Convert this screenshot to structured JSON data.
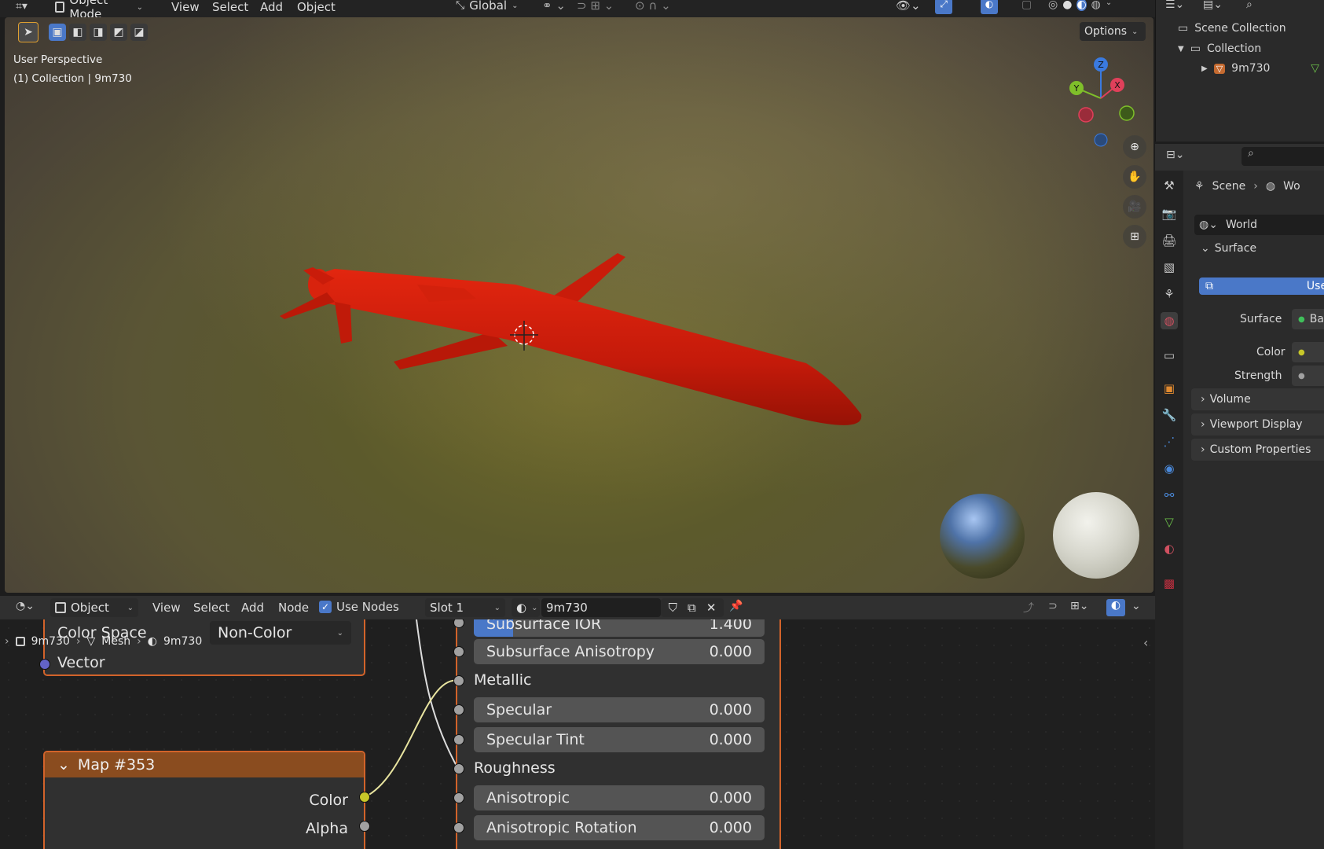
{
  "header": {
    "mode": "Object Mode",
    "menus": [
      "View",
      "Select",
      "Add",
      "Object"
    ],
    "transform_orientation": "Global"
  },
  "tool_header": {
    "options": "Options"
  },
  "viewport": {
    "perspective": "User Perspective",
    "collection_info": "(1) Collection | 9m730",
    "gizmo": {
      "z": "Z",
      "y": "Y",
      "x": "X"
    }
  },
  "node_header": {
    "object": "Object",
    "menus": [
      "View",
      "Select",
      "Add",
      "Node"
    ],
    "use_nodes": "Use Nodes",
    "slot": "Slot 1",
    "material": "9m730"
  },
  "breadcrumb": {
    "object": "9m730",
    "mesh": "Mesh",
    "material": "9m730"
  },
  "nodes": {
    "image_node": {
      "color_space_label": "Color Space",
      "color_space_value": "Non-Color",
      "vector": "Vector"
    },
    "map_node": {
      "title": "Map #353",
      "color": "Color",
      "alpha": "Alpha"
    },
    "bsdf": {
      "subsurface_ior": {
        "label": "Subsurface IOR",
        "value": "1.400"
      },
      "subsurface_anisotropy": {
        "label": "Subsurface Anisotropy",
        "value": "0.000"
      },
      "metallic": "Metallic",
      "specular": {
        "label": "Specular",
        "value": "0.000"
      },
      "specular_tint": {
        "label": "Specular Tint",
        "value": "0.000"
      },
      "roughness": "Roughness",
      "anisotropic": {
        "label": "Anisotropic",
        "value": "0.000"
      },
      "anisotropic_rotation": {
        "label": "Anisotropic Rotation",
        "value": "0.000"
      }
    }
  },
  "outliner": {
    "scene_collection": "Scene Collection",
    "collection": "Collection",
    "object": "9m730"
  },
  "properties": {
    "breadcrumb_scene": "Scene",
    "breadcrumb_world": "Wo",
    "world": "World",
    "surface_panel": "Surface",
    "use_nodes_btn": "Use N",
    "surface_label": "Surface",
    "surface_value": "Ba",
    "color_label": "Color",
    "strength_label": "Strength",
    "panels": [
      "Volume",
      "Viewport Display",
      "Custom Properties"
    ]
  },
  "colors": {
    "accent": "#4a78c8",
    "node_border": "#d2632a",
    "map_header": "#8a4c1f",
    "model": "#c41a0a"
  }
}
